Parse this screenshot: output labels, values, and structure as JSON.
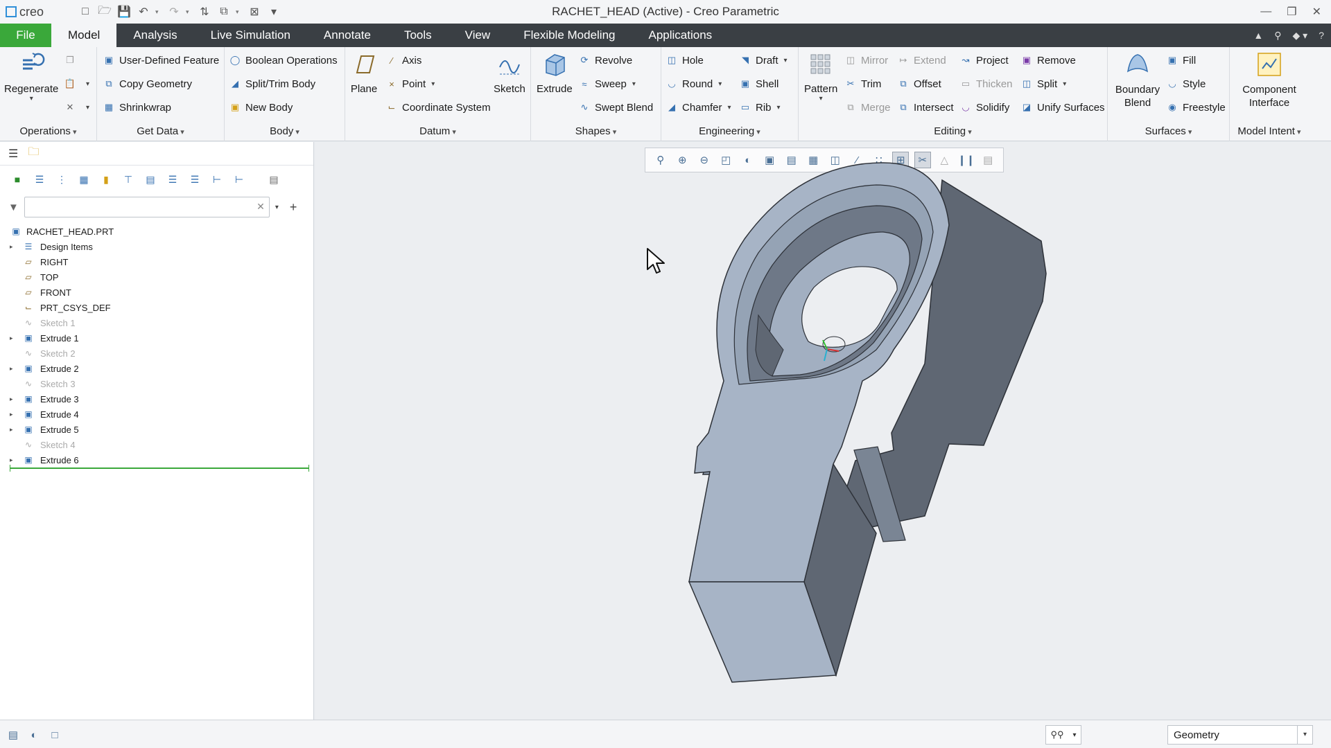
{
  "app": {
    "logo": "creo",
    "window_title": "RACHET_HEAD (Active) - Creo Parametric"
  },
  "tabs": [
    "File",
    "Model",
    "Analysis",
    "Live Simulation",
    "Annotate",
    "Tools",
    "View",
    "Flexible Modeling",
    "Applications"
  ],
  "active_tab": "Model",
  "ribbon": {
    "groups": {
      "operations": "Operations",
      "get_data": "Get Data",
      "body": "Body",
      "datum": "Datum",
      "shapes": "Shapes",
      "engineering": "Engineering",
      "editing": "Editing",
      "surfaces": "Surfaces",
      "model_intent": "Model Intent"
    },
    "regenerate": "Regenerate",
    "user_defined_feature": "User-Defined Feature",
    "copy_geometry": "Copy Geometry",
    "shrinkwrap": "Shrinkwrap",
    "boolean_operations": "Boolean Operations",
    "split_trim_body": "Split/Trim Body",
    "new_body": "New Body",
    "plane": "Plane",
    "axis": "Axis",
    "point": "Point",
    "coordinate_system": "Coordinate System",
    "sketch": "Sketch",
    "extrude": "Extrude",
    "revolve": "Revolve",
    "sweep": "Sweep",
    "swept_blend": "Swept Blend",
    "hole": "Hole",
    "round": "Round",
    "chamfer": "Chamfer",
    "draft": "Draft",
    "shell": "Shell",
    "rib": "Rib",
    "pattern": "Pattern",
    "mirror": "Mirror",
    "trim": "Trim",
    "merge": "Merge",
    "extend": "Extend",
    "offset": "Offset",
    "intersect": "Intersect",
    "project": "Project",
    "thicken": "Thicken",
    "solidify": "Solidify",
    "remove": "Remove",
    "split": "Split",
    "unify_surfaces": "Unify Surfaces",
    "boundary_blend": "Boundary Blend",
    "fill": "Fill",
    "style": "Style",
    "freestyle": "Freestyle",
    "component_interface": "Component Interface"
  },
  "model_tree": {
    "search_placeholder": "",
    "root": "RACHET_HEAD.PRT",
    "items": [
      {
        "label": "Design Items",
        "icon": "design-items-icon",
        "expand": true,
        "dim": false
      },
      {
        "label": "RIGHT",
        "icon": "datum-plane-icon",
        "expand": false,
        "dim": false
      },
      {
        "label": "TOP",
        "icon": "datum-plane-icon",
        "expand": false,
        "dim": false
      },
      {
        "label": "FRONT",
        "icon": "datum-plane-icon",
        "expand": false,
        "dim": false
      },
      {
        "label": "PRT_CSYS_DEF",
        "icon": "csys-icon",
        "expand": false,
        "dim": false
      },
      {
        "label": "Sketch 1",
        "icon": "sketch-icon",
        "expand": false,
        "dim": true
      },
      {
        "label": "Extrude 1",
        "icon": "extrude-icon",
        "expand": true,
        "dim": false
      },
      {
        "label": "Sketch 2",
        "icon": "sketch-icon",
        "expand": false,
        "dim": true
      },
      {
        "label": "Extrude 2",
        "icon": "extrude-icon",
        "expand": true,
        "dim": false
      },
      {
        "label": "Sketch 3",
        "icon": "sketch-icon",
        "expand": false,
        "dim": true
      },
      {
        "label": "Extrude 3",
        "icon": "extrude-icon",
        "expand": true,
        "dim": false
      },
      {
        "label": "Extrude 4",
        "icon": "extrude-icon",
        "expand": true,
        "dim": false
      },
      {
        "label": "Extrude 5",
        "icon": "extrude-icon",
        "expand": true,
        "dim": false
      },
      {
        "label": "Sketch 4",
        "icon": "sketch-icon",
        "expand": false,
        "dim": true
      },
      {
        "label": "Extrude 6",
        "icon": "extrude-icon",
        "expand": true,
        "dim": false
      }
    ]
  },
  "status": {
    "filter_value": "Geometry"
  },
  "colors": {
    "file_tab": "#3aa83a",
    "tab_bar": "#3a3f44",
    "model_face": "#a7b4c6",
    "model_side": "#5f6773"
  }
}
